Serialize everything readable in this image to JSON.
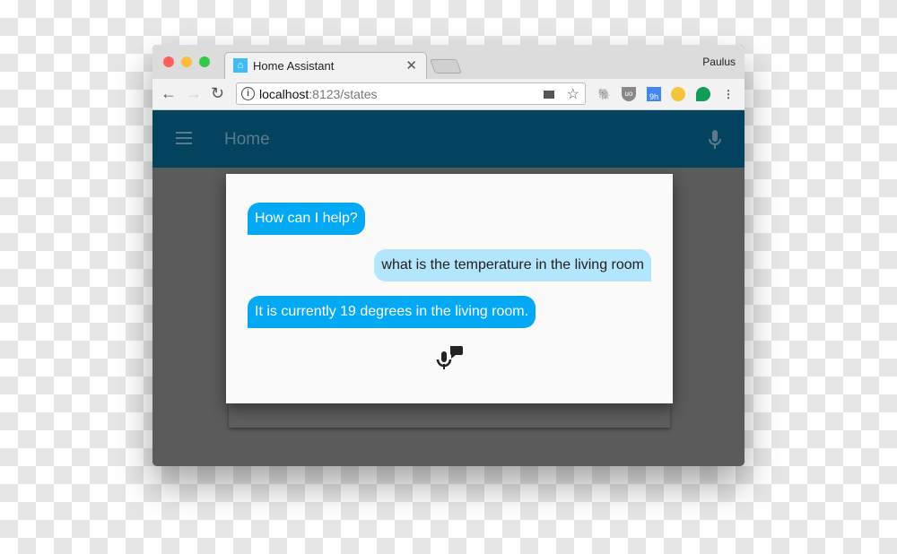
{
  "browser": {
    "tab_title": "Home Assistant",
    "profile": "Paulus",
    "url_host": "localhost",
    "url_rest": ":8123/states",
    "extensions": [
      "evernote-icon",
      "ublock-icon",
      "calendar-9h-icon",
      "emoji-icon",
      "hangouts-icon"
    ],
    "calendar_badge": "9h"
  },
  "app": {
    "header_title": "Home",
    "accent": "#03a9f4",
    "header_color": "#03435f"
  },
  "dialog": {
    "messages": [
      {
        "from": "hass",
        "text": "How can I help?"
      },
      {
        "from": "user",
        "text": "what is the temperature in the living room"
      },
      {
        "from": "hass",
        "text": "It is currently 19 degrees in the living room."
      }
    ]
  }
}
